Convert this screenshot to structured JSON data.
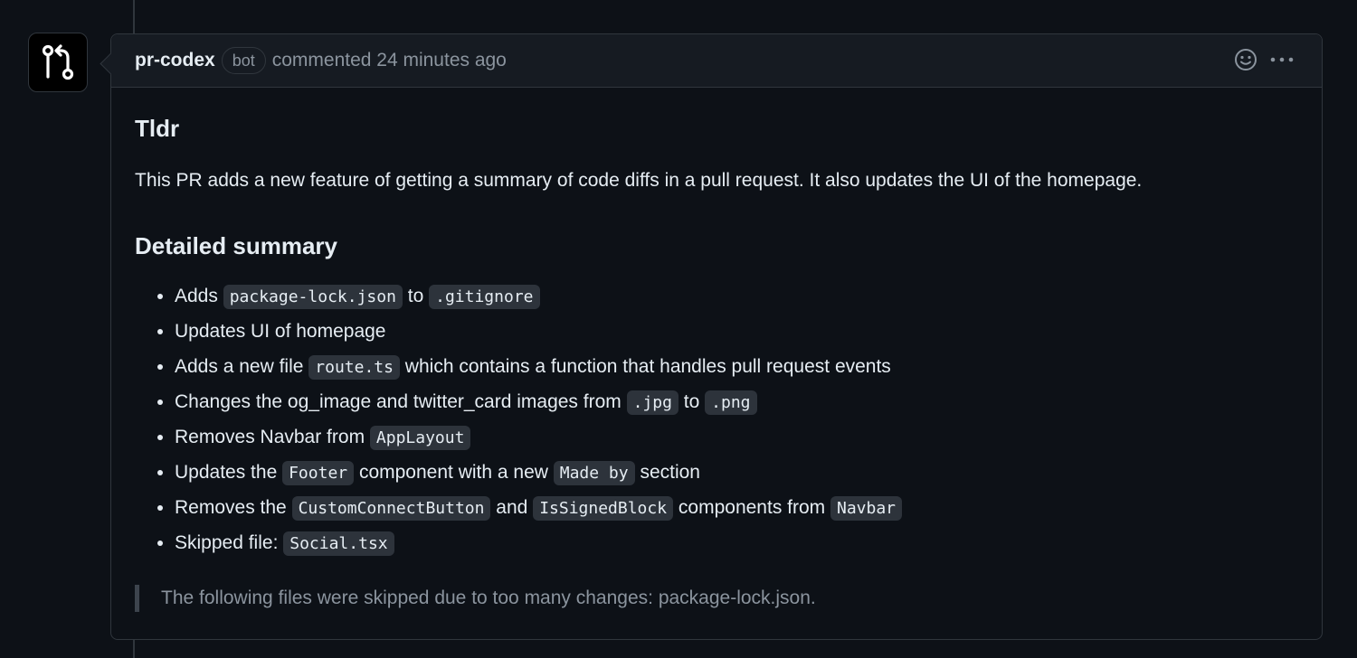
{
  "comment": {
    "author": "pr-codex",
    "badge": "bot",
    "meta": "commented 24 minutes ago"
  },
  "body": {
    "tldr_heading": "Tldr",
    "tldr_text": "This PR adds a new feature of getting a summary of code diffs in a pull request. It also updates the UI of the homepage.",
    "summary_heading": "Detailed summary",
    "items": [
      {
        "t1": "Adds ",
        "c1": "package-lock.json",
        "t2": " to ",
        "c2": ".gitignore"
      },
      {
        "t1": "Updates UI of homepage"
      },
      {
        "t1": "Adds a new file ",
        "c1": "route.ts",
        "t2": " which contains a function that handles pull request events"
      },
      {
        "t1": "Changes the og_image and twitter_card images from ",
        "c1": ".jpg",
        "t2": " to ",
        "c2": ".png"
      },
      {
        "t1": "Removes Navbar from ",
        "c1": "AppLayout"
      },
      {
        "t1": "Updates the ",
        "c1": "Footer",
        "t2": " component with a new ",
        "c2": "Made by",
        "t3": " section"
      },
      {
        "t1": "Removes the ",
        "c1": "CustomConnectButton",
        "t2": " and ",
        "c2": "IsSignedBlock",
        "t3": " components from ",
        "c3": "Navbar"
      },
      {
        "t1": "Skipped file: ",
        "c1": "Social.tsx"
      }
    ],
    "skipped_note": "The following files were skipped due to too many changes: package-lock.json."
  },
  "icons": {
    "avatar": "git-pull-request-icon",
    "reaction": "smiley-icon",
    "more": "kebab-horizontal-icon"
  },
  "colors": {
    "background": "#0d1117",
    "header": "#161b22",
    "border": "#30363d",
    "muted": "#8b949e",
    "text": "#e6edf3",
    "code_bg": "#2d333b"
  }
}
